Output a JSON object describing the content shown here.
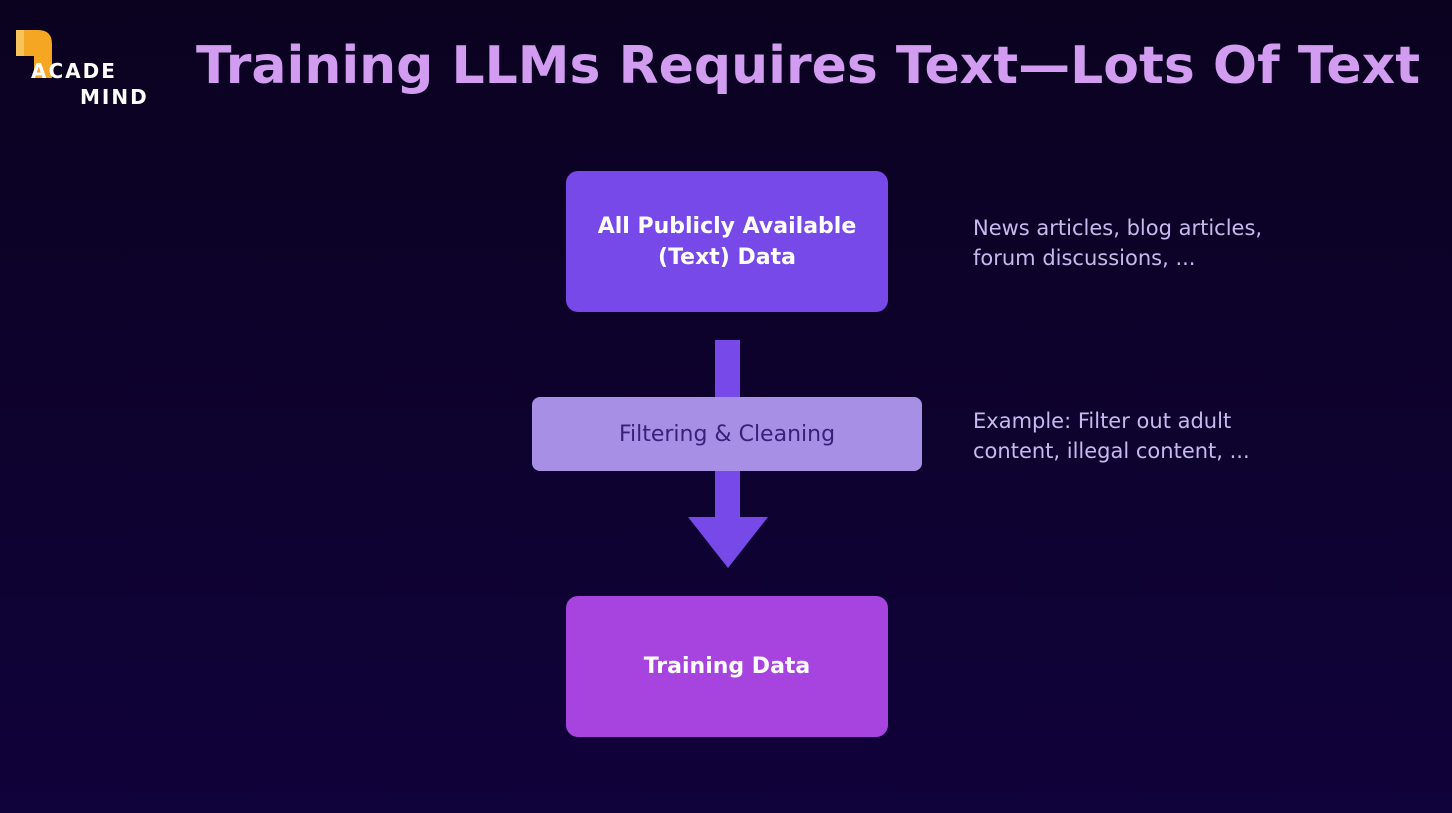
{
  "logo": {
    "line1": "ACADE",
    "line2": "MIND"
  },
  "title": "Training LLMs Requires Text—Lots Of Text",
  "diagram": {
    "source_box": {
      "line1": "All Publicly Available",
      "line2": "(Text) Data"
    },
    "filter_box": {
      "label": "Filtering & Cleaning"
    },
    "training_box": {
      "label": "Training Data"
    },
    "notes": {
      "source": {
        "line1": "News articles, blog articles,",
        "line2": "forum discussions, ..."
      },
      "filter": {
        "line1": "Example: Filter out adult",
        "line2": "content, illegal content, ..."
      }
    }
  },
  "colors": {
    "background": "#0e0230",
    "title": "#d29cf0",
    "source_box": "#7649e8",
    "filter_box": "#a78fe6",
    "training_box": "#a744e0",
    "arrow": "#7649e8",
    "note_text": "#c9b8ef",
    "logo_accent": "#f5a623"
  },
  "icons": {
    "logo": "academind-logo-icon",
    "arrow": "arrow-down-icon"
  }
}
